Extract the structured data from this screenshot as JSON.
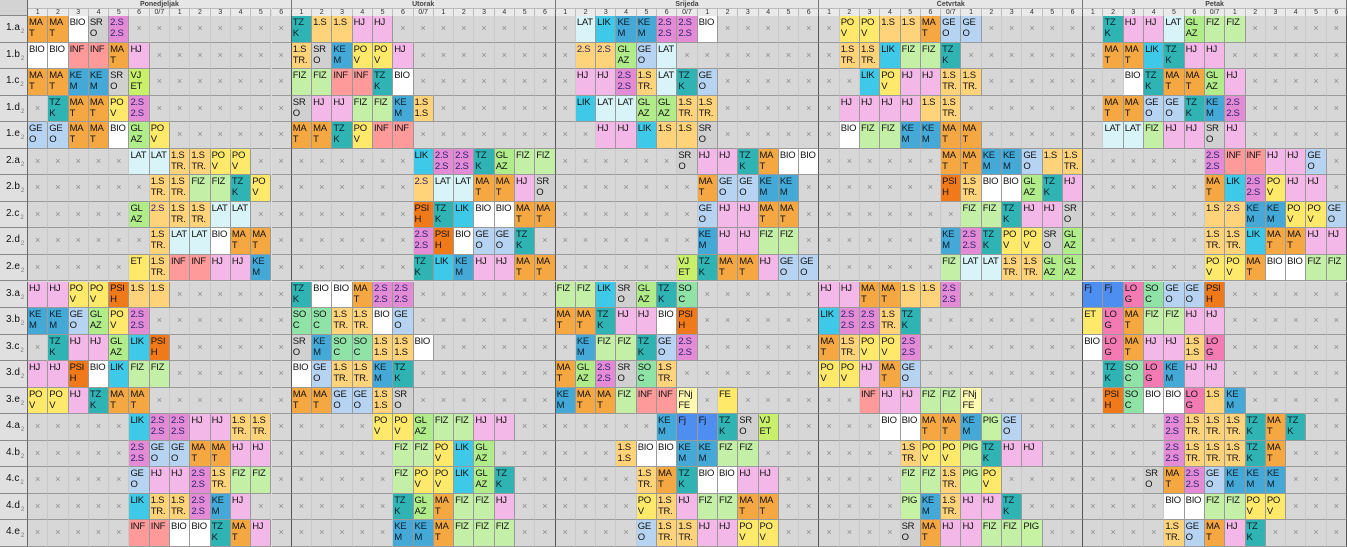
{
  "days": [
    "Ponedjeljak",
    "Utorak",
    "Srijeda",
    "Četvrtak",
    "Petak"
  ],
  "periods": [
    "1",
    "2",
    "3",
    "4",
    "5",
    "6",
    "0/7",
    "1",
    "2",
    "3",
    "4",
    "5",
    "6"
  ],
  "classes": [
    "1.a",
    "1.b",
    "1.c",
    "1.d",
    "1.e",
    "2.a",
    "2.b",
    "2.c",
    "2.d",
    "2.e",
    "3.a",
    "3.b",
    "3.c",
    "3.d",
    "3.e",
    "4.a",
    "4.b",
    "4.c",
    "4.d",
    "4.e"
  ],
  "class_suffix": "2",
  "empty_mark": "×",
  "colors": {
    "MAT": "#f5a742",
    "HJ": "#f4b8e8",
    "BIO": "#ffffff",
    "INF": "#ff9a9a",
    "KEM": "#44a9d6",
    "POV": "#ffe96b",
    "LAT": "#d8f4f8",
    "LIK": "#3ec9e8",
    "GEO": "#b6d4f2",
    "FIZ": "#c3f0a6",
    "TZK": "#2fb3b3",
    "SOC": "#8fe3a7",
    "GLAZ": "#b0ec8a",
    "VJET": "#c8f06a",
    "PSIH": "#f07a1a",
    "STR": "#ffd37a",
    "DS": "#e48bd6",
    "SRO": "#d0d0d0",
    "PIG": "#c5f3a3",
    "ET": "#ffe96b",
    "FJ": "#4d8ef0",
    "FNJ": "#fff9b0",
    "FE": "#ffe96b",
    "LOG": "#f47ab4",
    "X": "#d7d7d7"
  },
  "abbr": {
    "MAT": "MA\nT",
    "HJ": "HJ",
    "BIO": "BIO",
    "INF": "INF",
    "KEM": "KE\nM",
    "POV": "PO\nV",
    "LAT": "LAT",
    "LIK": "LIK",
    "GEO": "GE\nO",
    "FIZ": "FIZ",
    "TZK": "TZ\nK",
    "SOC": "SO\nC",
    "GLAZ": "GL\nAZ",
    "VJET": "VJ\nET",
    "PSIH": "PSI\nH",
    "STR": "1.S\nTR.",
    "DS": "2.S\n2.S",
    "SRO": "SR\nO",
    "PIG": "PIG",
    "ET": "ET",
    "FJ": "Fj",
    "FNJ": "FNj\nFE",
    "FE": "FE",
    "LOG": "LO\nG",
    "SS": "1.S\n1.S",
    "S1": "1.S",
    "S2": "2.S"
  },
  "schedule": [
    [
      "MAT",
      "MAT",
      "BIO",
      "SRO",
      "DS",
      "X",
      "X",
      "X",
      "X",
      "X",
      "X",
      "X",
      "X",
      "TZK",
      "S1",
      "S1",
      "HJ",
      "HJ",
      "X",
      "X",
      "X",
      "X",
      "X",
      "X",
      "X",
      "X",
      "X",
      "LAT",
      "LIK",
      "KEM",
      "KEM",
      "DS",
      "DS",
      "BIO",
      "X",
      "X",
      "X",
      "X",
      "X",
      "X",
      "POV",
      "POV",
      "S1",
      "S1",
      "MAT",
      "GEO",
      "GEO",
      "X",
      "X",
      "X",
      "X",
      "X",
      "X",
      "TZK",
      "HJ",
      "HJ",
      "LAT",
      "GLAZ",
      "FIZ",
      "FIZ",
      "X",
      "X",
      "X",
      "X",
      "X",
      "X"
    ],
    [
      "BIO",
      "BIO",
      "INF",
      "INF",
      "MAT",
      "HJ",
      "X",
      "X",
      "X",
      "X",
      "X",
      "X",
      "X",
      "STR",
      "SRO",
      "KEM",
      "POV",
      "POV",
      "HJ",
      "X",
      "X",
      "X",
      "X",
      "X",
      "X",
      "X",
      "X",
      "S2",
      "S2",
      "GLAZ",
      "GEO",
      "LAT",
      "X",
      "X",
      "X",
      "X",
      "X",
      "X",
      "X",
      "X",
      "STR",
      "STR",
      "LIK",
      "FIZ",
      "FIZ",
      "TZK",
      "X",
      "X",
      "X",
      "X",
      "X",
      "X",
      "X",
      "MAT",
      "MAT",
      "LIK",
      "TZK",
      "HJ",
      "HJ",
      "X",
      "X",
      "X",
      "X",
      "X",
      "X",
      "X"
    ],
    [
      "MAT",
      "MAT",
      "KEM",
      "KEM",
      "SRO",
      "VJET",
      "X",
      "X",
      "X",
      "X",
      "X",
      "X",
      "X",
      "FIZ",
      "FIZ",
      "INF",
      "INF",
      "TZK",
      "BIO",
      "X",
      "X",
      "X",
      "X",
      "X",
      "X",
      "X",
      "X",
      "HJ",
      "HJ",
      "DS",
      "STR",
      "LAT",
      "TZK",
      "GEO",
      "X",
      "X",
      "X",
      "X",
      "X",
      "X",
      "X",
      "LIK",
      "POV",
      "HJ",
      "HJ",
      "STR",
      "STR",
      "X",
      "X",
      "X",
      "X",
      "X",
      "X",
      "X",
      "BIO",
      "TZK",
      "MAT",
      "MAT",
      "GLAZ",
      "HJ",
      "X",
      "X",
      "X",
      "X",
      "X",
      "X"
    ],
    [
      "X",
      "TZK",
      "MAT",
      "MAT",
      "POV",
      "DS",
      "X",
      "X",
      "X",
      "X",
      "X",
      "X",
      "X",
      "SRO",
      "HJ",
      "HJ",
      "FIZ",
      "FIZ",
      "KEM",
      "SS",
      "X",
      "X",
      "X",
      "X",
      "X",
      "X",
      "X",
      "LIK",
      "LAT",
      "LAT",
      "GLAZ",
      "GLAZ",
      "STR",
      "STR",
      "X",
      "X",
      "X",
      "X",
      "X",
      "X",
      "HJ",
      "HJ",
      "HJ",
      "HJ",
      "S1",
      "STR",
      "X",
      "X",
      "X",
      "X",
      "X",
      "X",
      "X",
      "MAT",
      "MAT",
      "GEO",
      "GEO",
      "TZK",
      "KEM",
      "DS",
      "X",
      "X",
      "X",
      "X",
      "X",
      "X"
    ],
    [
      "GEO",
      "GEO",
      "MAT",
      "MAT",
      "BIO",
      "GLAZ",
      "POV",
      "X",
      "X",
      "X",
      "X",
      "X",
      "X",
      "MAT",
      "MAT",
      "TZK",
      "POV",
      "INF",
      "INF",
      "X",
      "X",
      "X",
      "X",
      "X",
      "X",
      "X",
      "X",
      "X",
      "HJ",
      "HJ",
      "LIK",
      "S1",
      "S1",
      "SRO",
      "X",
      "X",
      "X",
      "X",
      "X",
      "X",
      "BIO",
      "FIZ",
      "FIZ",
      "KEM",
      "KEM",
      "MAT",
      "MAT",
      "X",
      "X",
      "X",
      "X",
      "X",
      "X",
      "LAT",
      "LAT",
      "FIZ",
      "HJ",
      "HJ",
      "SRO",
      "HJ",
      "X",
      "X",
      "X",
      "X",
      "X",
      "X"
    ],
    [
      "X",
      "X",
      "X",
      "X",
      "X",
      "LAT",
      "LAT",
      "STR",
      "STR",
      "POV",
      "POV",
      "X",
      "X",
      "X",
      "X",
      "X",
      "X",
      "X",
      "X",
      "LIK",
      "DS",
      "DS",
      "TZK",
      "GLAZ",
      "FIZ",
      "FIZ",
      "X",
      "X",
      "X",
      "X",
      "X",
      "X",
      "SRO",
      "HJ",
      "HJ",
      "TZK",
      "MAT",
      "BIO",
      "BIO",
      "X",
      "X",
      "X",
      "X",
      "X",
      "X",
      "MAT",
      "MAT",
      "KEM",
      "KEM",
      "GEO",
      "S1",
      "STR",
      "X",
      "X",
      "X",
      "X",
      "X",
      "X",
      "DS",
      "INF",
      "INF",
      "HJ",
      "HJ",
      "GEO"
    ],
    [
      "X",
      "X",
      "X",
      "X",
      "X",
      "X",
      "STR",
      "STR",
      "FIZ",
      "FIZ",
      "TZK",
      "POV",
      "X",
      "X",
      "X",
      "X",
      "X",
      "X",
      "X",
      "S2",
      "LAT",
      "LAT",
      "MAT",
      "MAT",
      "HJ",
      "SRO",
      "X",
      "X",
      "X",
      "X",
      "X",
      "X",
      "X",
      "MAT",
      "GEO",
      "GEO",
      "KEM",
      "KEM",
      "X",
      "X",
      "X",
      "X",
      "X",
      "X",
      "X",
      "PSIH",
      "STR",
      "BIO",
      "BIO",
      "GLAZ",
      "TZK",
      "HJ",
      "X",
      "X",
      "X",
      "X",
      "X",
      "X",
      "MAT",
      "LIK",
      "DS",
      "POV",
      "HJ",
      "HJ"
    ],
    [
      "X",
      "X",
      "X",
      "X",
      "X",
      "GLAZ",
      "S2",
      "STR",
      "STR",
      "LAT",
      "LAT",
      "X",
      "X",
      "X",
      "X",
      "X",
      "X",
      "X",
      "X",
      "PSIH",
      "TZK",
      "LIK",
      "BIO",
      "BIO",
      "MAT",
      "MAT",
      "X",
      "X",
      "X",
      "X",
      "X",
      "X",
      "X",
      "GEO",
      "HJ",
      "HJ",
      "MAT",
      "MAT",
      "X",
      "X",
      "X",
      "X",
      "X",
      "X",
      "X",
      "X",
      "FIZ",
      "FIZ",
      "TZK",
      "HJ",
      "HJ",
      "SRO",
      "X",
      "X",
      "X",
      "X",
      "X",
      "X",
      "S1",
      "S2",
      "KEM",
      "KEM",
      "POV",
      "POV",
      "GEO"
    ],
    [
      "X",
      "X",
      "X",
      "X",
      "X",
      "X",
      "STR",
      "LAT",
      "LAT",
      "BIO",
      "MAT",
      "MAT",
      "X",
      "X",
      "X",
      "X",
      "X",
      "X",
      "X",
      "DS",
      "PSIH",
      "BIO",
      "GEO",
      "GEO",
      "TZK",
      "X",
      "X",
      "X",
      "X",
      "X",
      "X",
      "X",
      "X",
      "KEM",
      "HJ",
      "HJ",
      "FIZ",
      "FIZ",
      "X",
      "X",
      "X",
      "X",
      "X",
      "X",
      "X",
      "KEM",
      "DS",
      "TZK",
      "POV",
      "POV",
      "SRO",
      "GLAZ",
      "X",
      "X",
      "X",
      "X",
      "X",
      "X",
      "STR",
      "STR",
      "LIK",
      "MAT",
      "MAT",
      "HJ",
      "HJ"
    ],
    [
      "X",
      "X",
      "X",
      "X",
      "X",
      "ET",
      "STR",
      "INF",
      "INF",
      "HJ",
      "HJ",
      "KEM",
      "X",
      "X",
      "X",
      "X",
      "X",
      "X",
      "X",
      "TZK",
      "LIK",
      "KEM",
      "HJ",
      "HJ",
      "MAT",
      "MAT",
      "X",
      "X",
      "X",
      "X",
      "X",
      "X",
      "VJET",
      "TZK",
      "MAT",
      "MAT",
      "HJ",
      "GEO",
      "GEO",
      "X",
      "X",
      "X",
      "X",
      "X",
      "X",
      "FIZ",
      "LAT",
      "LAT",
      "STR",
      "STR",
      "GLAZ",
      "GLAZ",
      "X",
      "X",
      "X",
      "X",
      "X",
      "X",
      "POV",
      "POV",
      "MAT",
      "BIO",
      "BIO",
      "FIZ",
      "FIZ"
    ],
    [
      "HJ",
      "HJ",
      "POV",
      "POV",
      "PSIH",
      "S1",
      "S1",
      "X",
      "X",
      "X",
      "X",
      "X",
      "X",
      "TZK",
      "BIO",
      "BIO",
      "MAT",
      "DS",
      "DS",
      "X",
      "X",
      "X",
      "X",
      "X",
      "X",
      "X",
      "FIZ",
      "FIZ",
      "LIK",
      "SRO",
      "GLAZ",
      "TZK",
      "SOC",
      "X",
      "X",
      "X",
      "X",
      "X",
      "X",
      "HJ",
      "HJ",
      "MAT",
      "MAT",
      "S1",
      "S1",
      "DS",
      "X",
      "X",
      "X",
      "X",
      "X",
      "X",
      "FJ",
      "FJ",
      "LOG",
      "SOC",
      "GEO",
      "GEO",
      "PSIH",
      "X",
      "X",
      "X",
      "X",
      "X",
      "X"
    ],
    [
      "KEM",
      "KEM",
      "GEO",
      "GLAZ",
      "POV",
      "DS",
      "X",
      "X",
      "X",
      "X",
      "X",
      "X",
      "X",
      "SOC",
      "SOC",
      "STR",
      "STR",
      "BIO",
      "GEO",
      "X",
      "X",
      "X",
      "X",
      "X",
      "X",
      "X",
      "MAT",
      "MAT",
      "TZK",
      "HJ",
      "HJ",
      "BIO",
      "PSIH",
      "X",
      "X",
      "X",
      "X",
      "X",
      "X",
      "LIK",
      "DS",
      "DS",
      "STR",
      "TZK",
      "X",
      "X",
      "X",
      "X",
      "X",
      "X",
      "X",
      "X",
      "ET",
      "LOG",
      "MAT",
      "FIZ",
      "FIZ",
      "HJ",
      "HJ",
      "X",
      "X",
      "X",
      "X",
      "X",
      "X"
    ],
    [
      "X",
      "TZK",
      "HJ",
      "HJ",
      "GLAZ",
      "LIK",
      "PSIH",
      "X",
      "X",
      "X",
      "X",
      "X",
      "X",
      "SRO",
      "KEM",
      "SOC",
      "SOC",
      "SS",
      "SS",
      "BIO",
      "X",
      "X",
      "X",
      "X",
      "X",
      "X",
      "X",
      "KEM",
      "FIZ",
      "FIZ",
      "TZK",
      "GEO",
      "DS",
      "X",
      "X",
      "X",
      "X",
      "X",
      "X",
      "MAT",
      "STR",
      "POV",
      "POV",
      "DS",
      "X",
      "X",
      "X",
      "X",
      "X",
      "X",
      "X",
      "X",
      "BIO",
      "LOG",
      "MAT",
      "HJ",
      "HJ",
      "SS",
      "LOG",
      "X",
      "X",
      "X",
      "X",
      "X",
      "X"
    ],
    [
      "HJ",
      "HJ",
      "PSIH",
      "BIO",
      "LIK",
      "FIZ",
      "FIZ",
      "X",
      "X",
      "X",
      "X",
      "X",
      "X",
      "BIO",
      "GEO",
      "STR",
      "STR",
      "KEM",
      "TZK",
      "X",
      "X",
      "X",
      "X",
      "X",
      "X",
      "X",
      "MAT",
      "GLAZ",
      "DS",
      "SRO",
      "SOC",
      "STR",
      "X",
      "X",
      "X",
      "X",
      "X",
      "X",
      "X",
      "POV",
      "POV",
      "HJ",
      "MAT",
      "GEO",
      "X",
      "X",
      "X",
      "X",
      "X",
      "X",
      "X",
      "X",
      "X",
      "TZK",
      "SOC",
      "LOG",
      "KEM",
      "HJ",
      "HJ",
      "X",
      "X",
      "X",
      "X",
      "X",
      "X"
    ],
    [
      "POV",
      "POV",
      "HJ",
      "TZK",
      "MAT",
      "MAT",
      "X",
      "X",
      "X",
      "X",
      "X",
      "X",
      "X",
      "MAT",
      "MAT",
      "GEO",
      "GEO",
      "SS",
      "SRO",
      "X",
      "X",
      "X",
      "X",
      "X",
      "X",
      "X",
      "KEM",
      "MAT",
      "MAT",
      "FIZ",
      "INF",
      "INF",
      "FNJ",
      "X",
      "FE",
      "X",
      "X",
      "X",
      "X",
      "X",
      "X",
      "INF",
      "HJ",
      "HJ",
      "FIZ",
      "FIZ",
      "FNJ",
      "X",
      "X",
      "X",
      "X",
      "X",
      "X",
      "PSIH",
      "SOC",
      "BIO",
      "BIO",
      "LOG",
      "S1",
      "KEM",
      "X",
      "X",
      "X",
      "X",
      "X",
      "X"
    ],
    [
      "X",
      "X",
      "X",
      "X",
      "X",
      "LIK",
      "DS",
      "DS",
      "HJ",
      "HJ",
      "STR",
      "STR",
      "X",
      "X",
      "X",
      "X",
      "X",
      "POV",
      "POV",
      "GLAZ",
      "FIZ",
      "FIL",
      "HJ",
      "HJ",
      "X",
      "X",
      "X",
      "X",
      "X",
      "X",
      "X",
      "KEM",
      "FJ",
      "FJ",
      "TZK",
      "SRO",
      "VJET",
      "X",
      "X",
      "X",
      "X",
      "X",
      "BIO",
      "BIO",
      "MAT",
      "MAT",
      "KEM",
      "PIG",
      "GEO",
      "X",
      "X",
      "X",
      "X",
      "X",
      "X",
      "X",
      "DS",
      "STR",
      "STR",
      "STR",
      "TZK",
      "MAT",
      "TZK"
    ],
    [
      "X",
      "X",
      "X",
      "X",
      "X",
      "DS",
      "GEO",
      "GEO",
      "MAT",
      "MAT",
      "HJ",
      "HJ",
      "X",
      "X",
      "X",
      "X",
      "X",
      "X",
      "FIZ",
      "FIZ",
      "POV",
      "LIK",
      "GLAZ",
      "X",
      "X",
      "X",
      "X",
      "X",
      "X",
      "SS",
      "BIO",
      "BIO",
      "KEM",
      "KEM",
      "FIL",
      "FIL",
      "X",
      "X",
      "X",
      "X",
      "X",
      "X",
      "X",
      "STR",
      "POV",
      "POV",
      "PIG",
      "TZK",
      "HJ",
      "HJ",
      "X",
      "X",
      "X",
      "X",
      "X",
      "X",
      "DS",
      "STR",
      "STR",
      "STR",
      "TZK",
      "MAT",
      "X"
    ],
    [
      "X",
      "X",
      "X",
      "X",
      "X",
      "GEO",
      "HJ",
      "HJ",
      "DS",
      "STR",
      "FIZ",
      "FIZ",
      "X",
      "X",
      "X",
      "X",
      "X",
      "X",
      "FIZ",
      "POV",
      "POV",
      "LIK",
      "GLAZ",
      "TZK",
      "X",
      "X",
      "X",
      "X",
      "X",
      "X",
      "STR",
      "MAT",
      "TZK",
      "BIO",
      "BIO",
      "HJ",
      "HJ",
      "X",
      "X",
      "X",
      "X",
      "X",
      "X",
      "FIL",
      "FIL",
      "STR",
      "PIG",
      "POV",
      "X",
      "X",
      "X",
      "X",
      "X",
      "X",
      "X",
      "SRO",
      "MAT",
      "DS",
      "GEO",
      "KEM",
      "KEM",
      "KEM"
    ],
    [
      "X",
      "X",
      "X",
      "X",
      "X",
      "LIK",
      "STR",
      "STR",
      "DS",
      "KEM",
      "HJ",
      "X",
      "X",
      "X",
      "X",
      "X",
      "X",
      "X",
      "TZK",
      "GLAZ",
      "MAT",
      "FIZ",
      "FIL",
      "HJ",
      "X",
      "X",
      "X",
      "X",
      "X",
      "X",
      "POV",
      "STR",
      "HJ",
      "FIL",
      "FIL",
      "MAT",
      "MAT",
      "X",
      "X",
      "X",
      "X",
      "X",
      "X",
      "PIG",
      "KEM",
      "STR",
      "HJ",
      "HJ",
      "TZK",
      "X",
      "X",
      "X",
      "X",
      "X",
      "X",
      "X",
      "BIO",
      "BIO",
      "FIZ",
      "FIZ",
      "POV",
      "POV",
      "X"
    ],
    [
      "X",
      "X",
      "X",
      "X",
      "X",
      "INF",
      "INF",
      "BIO",
      "BIO",
      "TZK",
      "MAT",
      "HJ",
      "X",
      "X",
      "X",
      "X",
      "X",
      "X",
      "KEM",
      "KEM",
      "MAT",
      "FIZ",
      "FIL",
      "FIL",
      "X",
      "X",
      "X",
      "X",
      "X",
      "X",
      "GEO",
      "STR",
      "STR",
      "HJ",
      "HJ",
      "POV",
      "POV",
      "X",
      "X",
      "X",
      "X",
      "X",
      "X",
      "SRO",
      "MAT",
      "HJ",
      "HJ",
      "FIZ",
      "FIZ",
      "PIG",
      "X",
      "X",
      "X",
      "X",
      "X",
      "X",
      "STR",
      "GEO",
      "MAT",
      "HJ",
      "TZK",
      "X",
      "X"
    ]
  ]
}
